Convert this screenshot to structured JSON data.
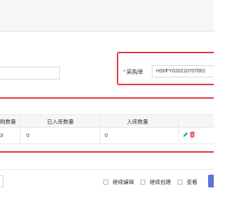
{
  "order_field": {
    "required_mark": "*",
    "label": "采购单",
    "value": "HS0FY020210707001"
  },
  "table": {
    "columns": [
      "购数量",
      "已入库数量",
      "入库数量"
    ],
    "row": {
      "partial_value": "3",
      "received": "0",
      "to_receive": "0"
    }
  },
  "footer": {
    "options": [
      "继续编辑",
      "继续创建",
      "查看"
    ]
  },
  "colors": {
    "highlight": "#e8373e",
    "primary": "#6272d8",
    "edit_icon": "#1a9e8f",
    "delete_icon": "#e8373e"
  },
  "icons": [
    "edit-icon",
    "delete-icon"
  ]
}
